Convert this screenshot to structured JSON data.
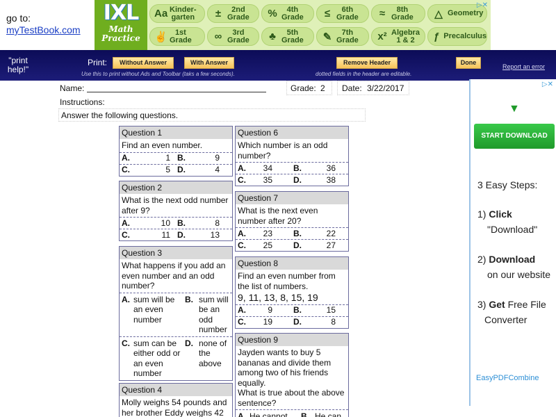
{
  "top": {
    "goto": "go to:",
    "link": "myTestBook.com"
  },
  "ixl": {
    "logo": "IXL",
    "line1": "Math",
    "line2": "Practice",
    "close": "▷✕",
    "buttons": [
      {
        "icon": "Aa",
        "label": "Kinder-\ngarten"
      },
      {
        "icon": "±",
        "label": "2nd\nGrade"
      },
      {
        "icon": "%",
        "label": "4th\nGrade"
      },
      {
        "icon": "≤",
        "label": "6th\nGrade"
      },
      {
        "icon": "≈",
        "label": "8th\nGrade"
      },
      {
        "icon": "△",
        "label": "Geometry"
      },
      {
        "icon": "✌",
        "label": "1st\nGrade"
      },
      {
        "icon": "∞",
        "label": "3rd\nGrade"
      },
      {
        "icon": "♣",
        "label": "5th\nGrade"
      },
      {
        "icon": "✎",
        "label": "7th\nGrade"
      },
      {
        "icon": "x²",
        "label": "Algebra\n1 & 2"
      },
      {
        "icon": "ƒ",
        "label": "Precalculus"
      }
    ]
  },
  "toolbar": {
    "print_help": "\"print help!\"",
    "print_label": "Print:",
    "without_answer": "Without Answer",
    "with_answer": "With Answer",
    "remove_header": "Remove Header",
    "done": "Done",
    "note_left": "Use this to print without Ads and Toolbar (taks a few seconds).",
    "note_right": "dotted fields in the header are editable.",
    "report_error": "Report an error"
  },
  "worksheet": {
    "name_label": "Name:",
    "grade_label": "Grade:",
    "grade_value": "2",
    "date_label": "Date:",
    "date_value": "3/22/2017",
    "instructions_label": "Instructions:",
    "instructions_text": "Answer the following questions."
  },
  "questions": {
    "q1": {
      "title": "Question 1",
      "text": "Find an even number.",
      "A": "1",
      "B": "9",
      "C": "5",
      "D": "4"
    },
    "q2": {
      "title": "Question 2",
      "text": "What is the next odd number after 9?",
      "A": "10",
      "B": "8",
      "C": "11",
      "D": "13"
    },
    "q3": {
      "title": "Question 3",
      "text": "What happens if you add an even number and an odd number?",
      "A": "sum will be an even number",
      "B": "sum will be an odd number",
      "C": "sum can be either odd or an even number",
      "D": "none of the above"
    },
    "q4": {
      "title": "Question 4",
      "text": "Molly weighs 54 pounds and her brother Eddy weighs 42"
    },
    "q6": {
      "title": "Question 6",
      "text": "Which number is an odd number?",
      "A": "34",
      "B": "36",
      "C": "35",
      "D": "38"
    },
    "q7": {
      "title": "Question 7",
      "text": "What is the next even number after 20?",
      "A": "23",
      "B": "22",
      "C": "25",
      "D": "27"
    },
    "q8": {
      "title": "Question 8",
      "text": "Find an even number from the list of numbers.",
      "list": "9, 11, 13, 8, 15, 19",
      "A": "9",
      "B": "15",
      "C": "19",
      "D": "8"
    },
    "q9": {
      "title": "Question 9",
      "text": "Jayden wants to buy 5 bananas and divide them among two of his friends equally.",
      "text2": "What is true about the above sentence?",
      "A": "He cannot",
      "B": "He can"
    }
  },
  "labels": {
    "A": "A.",
    "B": "B.",
    "C": "C.",
    "D": "D."
  },
  "side_ad": {
    "close": "▷✕",
    "arrow": "▼",
    "button": "START DOWNLOAD",
    "steps_title": "3 Easy Steps:",
    "step1_num": "1)",
    "step1_bold": "Click",
    "step1_rest": "\"Download\"",
    "step2_num": "2)",
    "step2_bold": "Download",
    "step2_rest": "on our website",
    "step3_num": "3)",
    "step3_bold": "Get",
    "step3_mid": "Free File",
    "step3_rest": "Converter",
    "brand": "EasyPDFCombine"
  }
}
